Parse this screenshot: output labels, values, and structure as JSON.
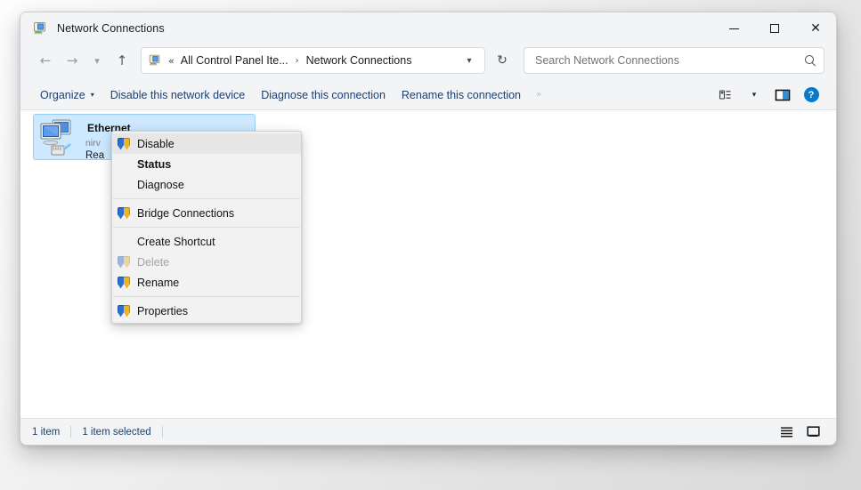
{
  "window": {
    "title": "Network Connections",
    "title_icon": "network-connections-icon",
    "caption": {
      "minimize_label": "Minimize",
      "maximize_label": "Maximize",
      "close_label": "Close"
    }
  },
  "nav": {
    "back_label": "Back",
    "forward_label": "Forward",
    "recent_label": "Recent locations",
    "up_label": "Up",
    "refresh_label": "Refresh",
    "address": {
      "overflow_chevron": "«",
      "crumbs": [
        "All Control Panel Ite...",
        "Network Connections"
      ],
      "separator": "›",
      "dropdown_caret": "⌄"
    },
    "search": {
      "placeholder": "Search Network Connections",
      "value": "",
      "icon": "search-icon"
    }
  },
  "commandbar": {
    "organize": "Organize",
    "organize_caret": "▾",
    "disable_device": "Disable this network device",
    "diagnose_connection": "Diagnose this connection",
    "rename_connection": "Rename this connection",
    "overflow": "»",
    "view_caret": "▾",
    "help_glyph": "?",
    "view_label": "Change your view",
    "preview_label": "Show the preview pane",
    "help_label": "Help"
  },
  "connection": {
    "name": "Ethernet",
    "network": "nirv",
    "adapter": "Rea",
    "icon": "ethernet-adapter-icon",
    "selected": true
  },
  "context_menu": {
    "items": [
      {
        "label": "Disable",
        "shield": true,
        "bold": false,
        "disabled": false,
        "hover": true
      },
      {
        "label": "Status",
        "shield": false,
        "bold": true,
        "disabled": false,
        "hover": false
      },
      {
        "label": "Diagnose",
        "shield": false,
        "bold": false,
        "disabled": false,
        "hover": false
      },
      {
        "label": "Bridge Connections",
        "shield": true,
        "bold": false,
        "disabled": false,
        "hover": false
      },
      {
        "label": "Create Shortcut",
        "shield": false,
        "bold": false,
        "disabled": false,
        "hover": false
      },
      {
        "label": "Delete",
        "shield": true,
        "bold": false,
        "disabled": true,
        "hover": false
      },
      {
        "label": "Rename",
        "shield": true,
        "bold": false,
        "disabled": false,
        "hover": false
      },
      {
        "label": "Properties",
        "shield": true,
        "bold": false,
        "disabled": false,
        "hover": false
      }
    ],
    "separator_after": [
      2,
      3,
      6
    ]
  },
  "statusbar": {
    "item_count": "1 item",
    "selection": "1 item selected",
    "details_view_label": "Details view",
    "large_icons_view_label": "Large icons view"
  },
  "colors": {
    "accent": "#0a7ac7",
    "command_text": "#1d3f6e",
    "selection_bg": "#cde8ff",
    "selection_border": "#99ccf3",
    "chrome_bg": "#f3f4f6",
    "shield_blue": "#2b6fd4",
    "shield_gold": "#f0b323"
  }
}
